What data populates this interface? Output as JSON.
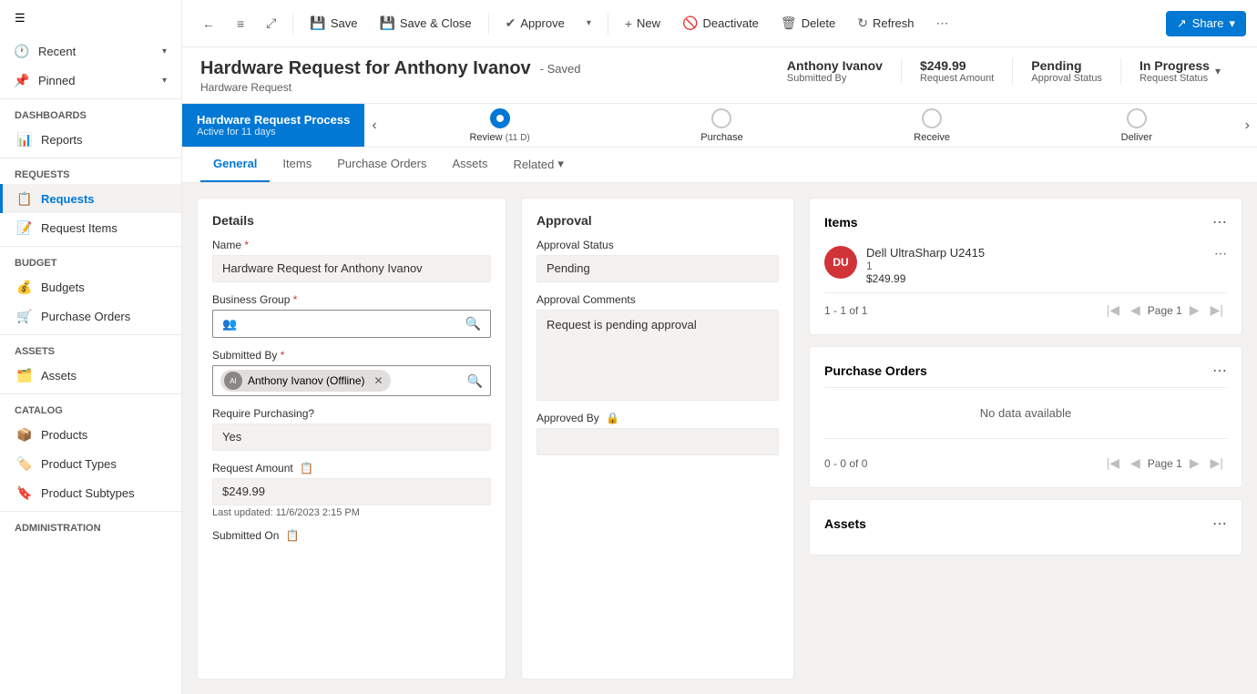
{
  "sidebar": {
    "hamburger_icon": "☰",
    "sections": [
      {
        "type": "collapse-item",
        "icon": "🕐",
        "label": "Recent",
        "chevron": "▾"
      },
      {
        "type": "collapse-item",
        "icon": "📌",
        "label": "Pinned",
        "chevron": "▾"
      }
    ],
    "dashboards_label": "Dashboards",
    "reports": {
      "icon": "📊",
      "label": "Reports"
    },
    "requests_section_label": "Requests",
    "requests_items": [
      {
        "icon": "📋",
        "label": "Requests",
        "active": true
      },
      {
        "icon": "📝",
        "label": "Request Items",
        "active": false
      }
    ],
    "budget_section_label": "Budget",
    "budget_items": [
      {
        "icon": "💰",
        "label": "Budgets",
        "active": false
      },
      {
        "icon": "🛒",
        "label": "Purchase Orders",
        "active": false
      }
    ],
    "assets_section_label": "Assets",
    "assets_items": [
      {
        "icon": "🗂️",
        "label": "Assets",
        "active": false
      }
    ],
    "catalog_section_label": "Catalog",
    "catalog_items": [
      {
        "icon": "📦",
        "label": "Products",
        "active": false
      },
      {
        "icon": "🏷️",
        "label": "Product Types",
        "active": false
      },
      {
        "icon": "🔖",
        "label": "Product Subtypes",
        "active": false
      }
    ],
    "administration_section_label": "Administration"
  },
  "toolbar": {
    "back_label": "←",
    "list_icon": "≡",
    "expand_icon": "⤢",
    "save_label": "Save",
    "save_close_label": "Save & Close",
    "approve_label": "Approve",
    "dropdown_arrow": "▾",
    "new_label": "New",
    "deactivate_label": "Deactivate",
    "delete_label": "Delete",
    "refresh_label": "Refresh",
    "more_icon": "⋯",
    "share_label": "Share",
    "share_dropdown": "▾"
  },
  "record": {
    "title": "Hardware Request for Anthony Ivanov",
    "saved_badge": "- Saved",
    "subtitle": "Hardware Request",
    "submitted_by_label": "Submitted By",
    "submitted_by_value": "Anthony Ivanov",
    "request_amount_label": "Request Amount",
    "request_amount_value": "$249.99",
    "approval_status_label": "Approval Status",
    "approval_status_value": "Pending",
    "request_status_label": "Request Status",
    "request_status_value": "In Progress",
    "status_chevron": "▾"
  },
  "process_bar": {
    "active_title": "Hardware Request Process",
    "active_sub": "Active for 11 days",
    "prev_icon": "‹",
    "next_icon": "›",
    "steps": [
      {
        "label": "Review",
        "days": "(11 D)",
        "active": true
      },
      {
        "label": "Purchase",
        "days": "",
        "active": false
      },
      {
        "label": "Receive",
        "days": "",
        "active": false
      },
      {
        "label": "Deliver",
        "days": "",
        "active": false
      }
    ]
  },
  "tabs": [
    {
      "label": "General",
      "active": true
    },
    {
      "label": "Items",
      "active": false
    },
    {
      "label": "Purchase Orders",
      "active": false
    },
    {
      "label": "Assets",
      "active": false
    },
    {
      "label": "Related",
      "active": false,
      "has_arrow": true
    }
  ],
  "details": {
    "title": "Details",
    "name_label": "Name",
    "name_required": "*",
    "name_value": "Hardware Request for Anthony Ivanov",
    "business_group_label": "Business Group",
    "business_group_required": "*",
    "business_group_icon": "👥",
    "business_group_lookup_icon": "🔍",
    "submitted_by_label": "Submitted By",
    "submitted_by_required": "*",
    "submitted_by_person": "Anthony Ivanov (Offline)",
    "submitted_by_lookup_icon": "🔍",
    "require_purchasing_label": "Require Purchasing?",
    "require_purchasing_value": "Yes",
    "request_amount_label": "Request Amount",
    "request_amount_icon": "📋",
    "request_amount_value": "$249.99",
    "last_updated_label": "Last updated:",
    "last_updated_value": "11/6/2023 2:15 PM",
    "submitted_on_label": "Submitted On",
    "submitted_on_icon": "📋"
  },
  "approval": {
    "title": "Approval",
    "status_label": "Approval Status",
    "status_value": "Pending",
    "comments_label": "Approval Comments",
    "comments_value": "Request is pending approval",
    "approved_by_label": "Approved By",
    "approved_by_icon": "🔒"
  },
  "items_panel": {
    "title": "Items",
    "more_icon": "⋯",
    "items": [
      {
        "avatar_initials": "DU",
        "avatar_color": "#d13438",
        "name": "Dell UltraSharp U2415",
        "qty": "1",
        "price": "$249.99"
      }
    ],
    "pagination_text": "1 - 1 of 1",
    "page_label": "Page 1",
    "first_icon": "|◀",
    "prev_icon": "◀",
    "next_icon": "▶",
    "last_icon": "▶|"
  },
  "purchase_orders_panel": {
    "title": "Purchase Orders",
    "more_icon": "⋯",
    "no_data": "No data available",
    "pagination_text": "0 - 0 of 0",
    "page_label": "Page 1",
    "first_icon": "|◀",
    "prev_icon": "◀",
    "next_icon": "▶",
    "last_icon": "▶|"
  },
  "assets_panel": {
    "title": "Assets"
  }
}
